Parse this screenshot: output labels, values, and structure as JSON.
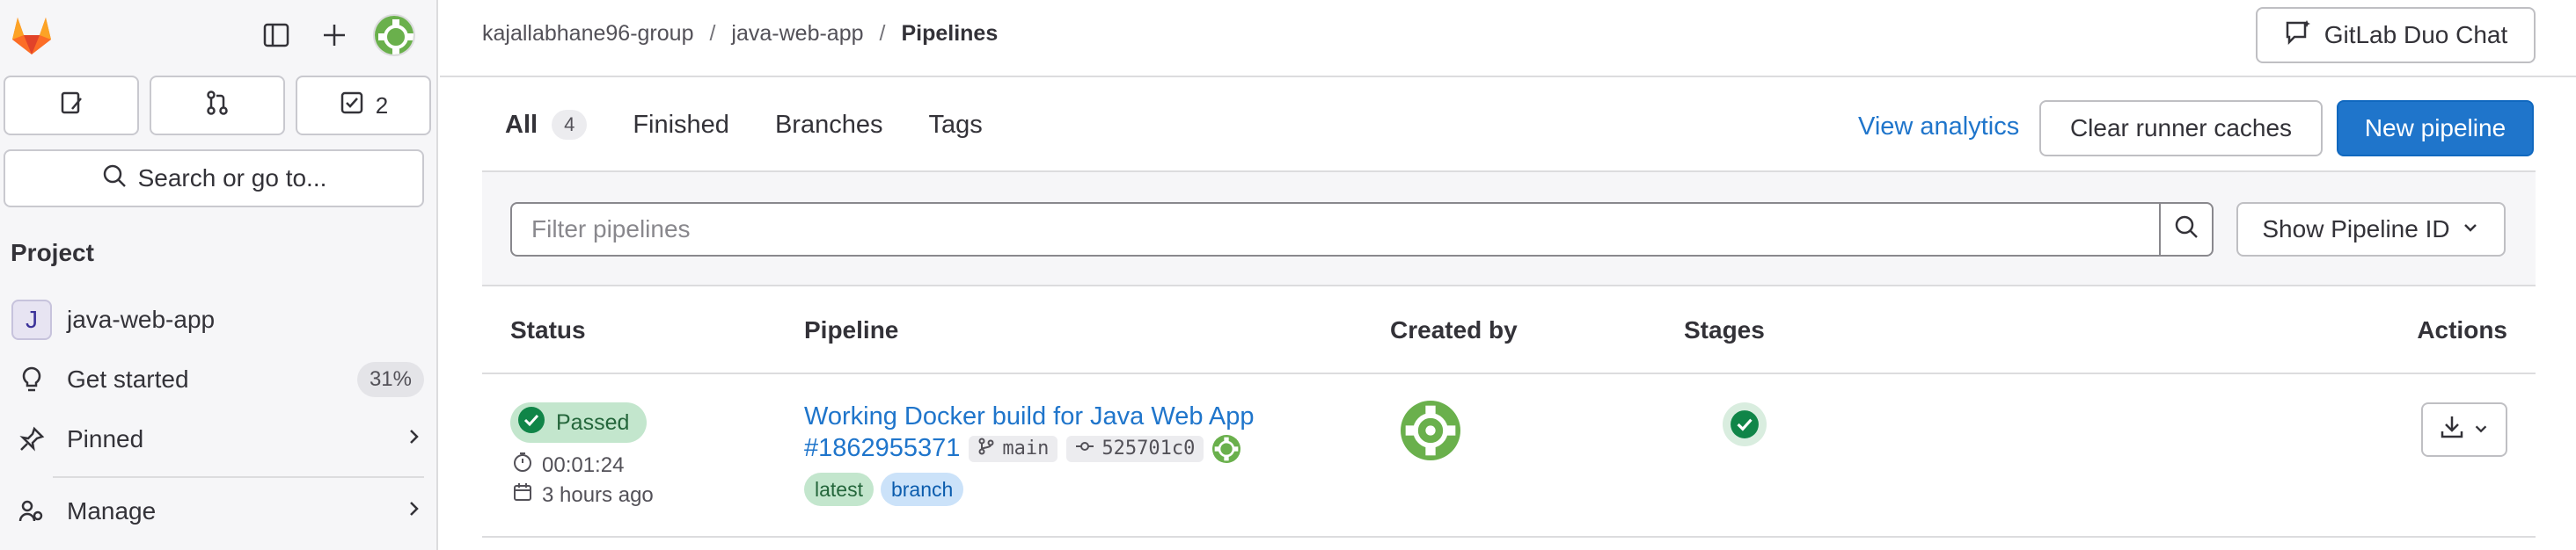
{
  "colors": {
    "accent": "#1f75cb",
    "success": "#108548",
    "brand_orange": "#e24329"
  },
  "sidebar": {
    "logo_icon": "gitlab-tanuki-icon",
    "counts": [
      {
        "icon": "issues-icon",
        "value": ""
      },
      {
        "icon": "merge-request-icon",
        "value": ""
      },
      {
        "icon": "todo-icon",
        "value": "2"
      }
    ],
    "search_label": "Search or go to...",
    "section_title": "Project",
    "items": [
      {
        "badge": "J",
        "label": "java-web-app"
      },
      {
        "icon": "lightbulb-icon",
        "label": "Get started",
        "badge": "31%"
      },
      {
        "icon": "pin-icon",
        "label": "Pinned"
      },
      {
        "icon": "manage-icon",
        "label": "Manage"
      }
    ]
  },
  "header": {
    "breadcrumb": [
      "kajallabhane96-group",
      "java-web-app",
      "Pipelines"
    ],
    "duo_label": "GitLab Duo Chat"
  },
  "tabs": [
    {
      "label": "All",
      "count": "4"
    },
    {
      "label": "Finished"
    },
    {
      "label": "Branches"
    },
    {
      "label": "Tags"
    }
  ],
  "actions": {
    "view_analytics": "View analytics",
    "clear_caches": "Clear runner caches",
    "new_pipeline": "New pipeline"
  },
  "filter": {
    "placeholder": "Filter pipelines",
    "show_id_label": "Show Pipeline ID"
  },
  "table": {
    "columns": [
      "Status",
      "Pipeline",
      "Created by",
      "Stages",
      "Actions"
    ],
    "rows": [
      {
        "status": "Passed",
        "duration": "00:01:24",
        "finished": "3 hours ago",
        "title": "Working Docker build for Java Web App",
        "id": "#1862955371",
        "ref": "main",
        "commit": "525701c0",
        "tags": [
          "latest",
          "branch"
        ]
      }
    ]
  }
}
